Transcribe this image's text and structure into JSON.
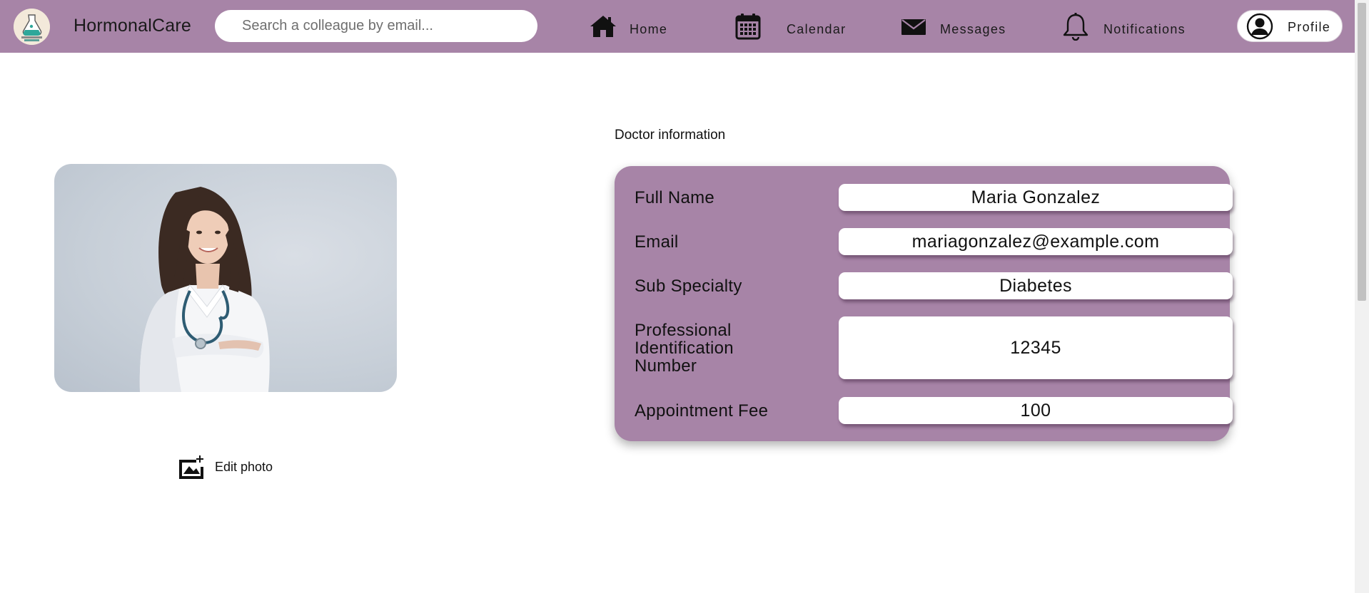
{
  "app": {
    "brand": "HormonalCare"
  },
  "search": {
    "placeholder": "Search a colleague by email..."
  },
  "nav": {
    "home": "Home",
    "calendar": "Calendar",
    "messages": "Messages",
    "notifications": "Notifications",
    "profile": "Profile"
  },
  "photo": {
    "edit_label": "Edit photo"
  },
  "doctor": {
    "section_title": "Doctor information",
    "fields": [
      {
        "label": "Full Name",
        "value": "Maria Gonzalez"
      },
      {
        "label": "Email",
        "value": "mariagonzalez@example.com"
      },
      {
        "label": "Sub Specialty",
        "value": "Diabetes"
      },
      {
        "label": "Professional Identification Number",
        "value": "12345"
      },
      {
        "label": "Appointment Fee",
        "value": "100"
      }
    ]
  },
  "colors": {
    "navbar": "#a784a7",
    "card": "#a784a7",
    "background": "#ffffff"
  },
  "icons": {
    "logo": "hormonalcare-logo",
    "home": "home-icon",
    "calendar": "calendar-icon",
    "messages": "envelope-icon",
    "notifications": "bell-icon",
    "profile": "user-circle-icon",
    "edit_photo": "edit-image-icon"
  }
}
